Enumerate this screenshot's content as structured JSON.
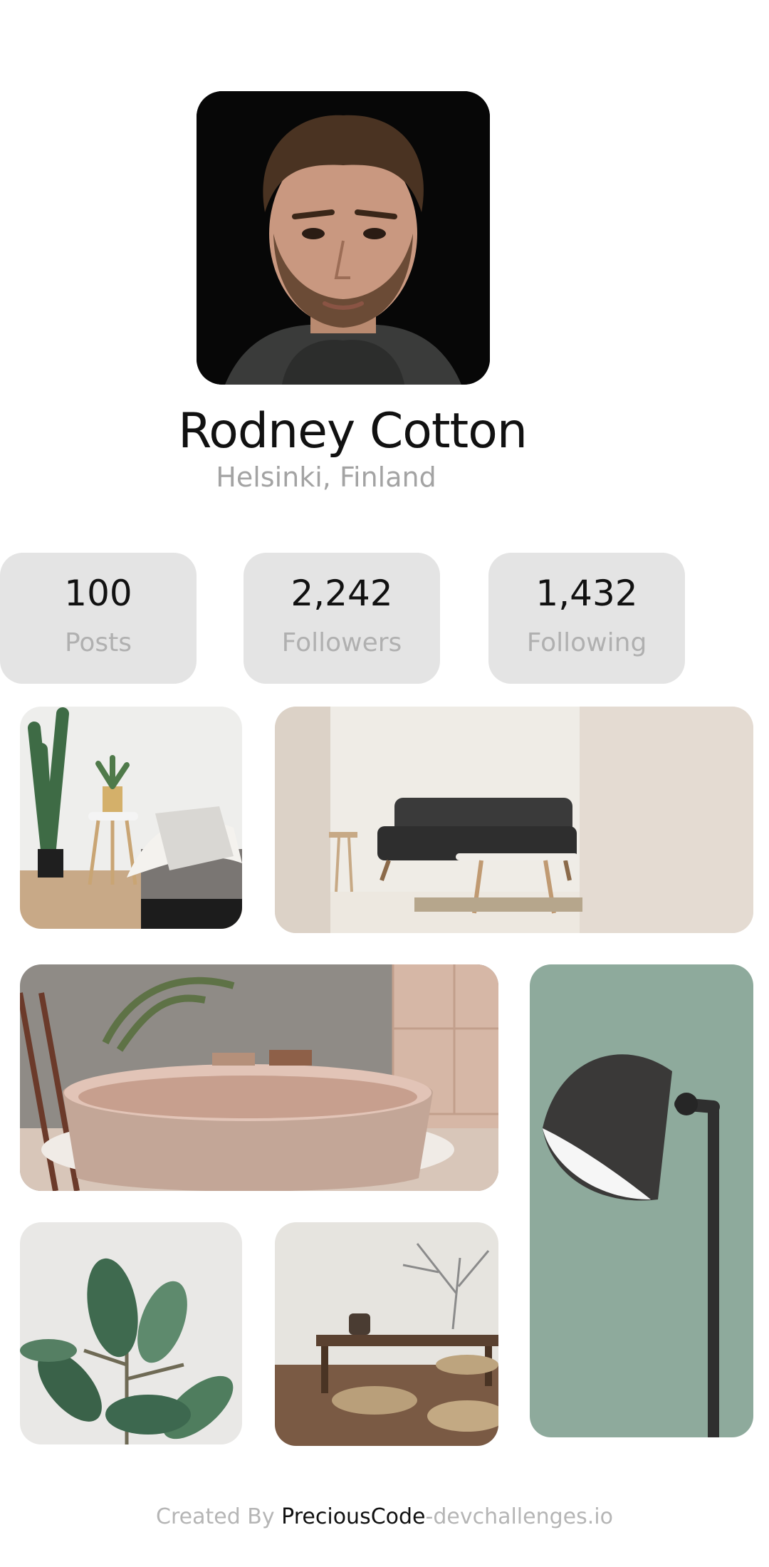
{
  "profile": {
    "name": "Rodney Cotton",
    "location": "Helsinki, Finland"
  },
  "stats": [
    {
      "value": "100",
      "label": "Posts"
    },
    {
      "value": "2,242",
      "label": "Followers"
    },
    {
      "value": "1,432",
      "label": "Following"
    }
  ],
  "gallery": [
    {
      "subject": "living-room-plant"
    },
    {
      "subject": "sofa-room"
    },
    {
      "subject": "bathtub"
    },
    {
      "subject": "floor-lamp"
    },
    {
      "subject": "rubber-plant"
    },
    {
      "subject": "low-table-room"
    }
  ],
  "footer": {
    "prefix": "Created By ",
    "author": "PreciousCode",
    "suffix": "-devchallenges.io"
  },
  "colors": {
    "stat_bg": "#e4e4e4",
    "muted_text": "#a3a3a3",
    "primary_text": "#111111"
  }
}
